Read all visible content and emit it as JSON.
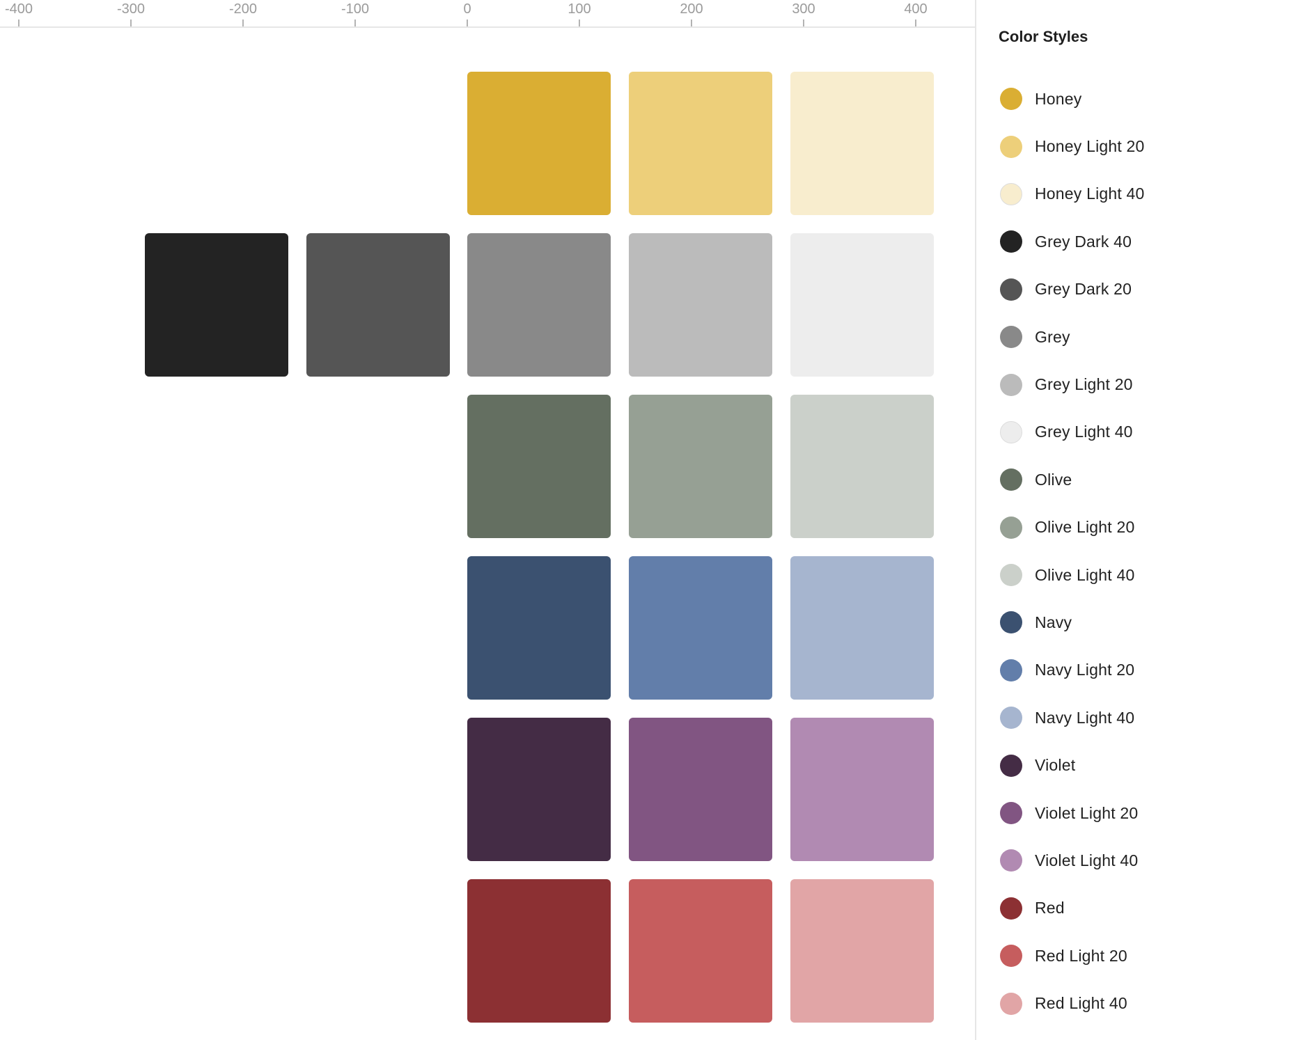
{
  "ruler": {
    "ticks": [
      "-400",
      "-300",
      "-200",
      "-100",
      "0",
      "100",
      "200",
      "300",
      "400"
    ]
  },
  "canvas": {
    "rows": [
      {
        "name": "honey",
        "swatches": [
          "",
          "",
          "#DAAE33",
          "#EDCF7A",
          "#F8EDCE"
        ]
      },
      {
        "name": "grey",
        "swatches": [
          "#232323",
          "#555555",
          "#898989",
          "#BBBBBB",
          "#EDEDED"
        ]
      },
      {
        "name": "olive",
        "swatches": [
          "",
          "",
          "#646F61",
          "#96A094",
          "#CBD0CA"
        ]
      },
      {
        "name": "navy",
        "swatches": [
          "",
          "",
          "#3B5170",
          "#627EAA",
          "#A6B5CF"
        ]
      },
      {
        "name": "violet",
        "swatches": [
          "",
          "",
          "#442C45",
          "#815582",
          "#B18AB2"
        ]
      },
      {
        "name": "red",
        "swatches": [
          "",
          "",
          "#8C3033",
          "#C65D5E",
          "#E1A5A6"
        ]
      }
    ]
  },
  "panel": {
    "title": "Color Styles",
    "styles": [
      {
        "label": "Honey",
        "color": "#DAAE33"
      },
      {
        "label": "Honey Light 20",
        "color": "#EDCF7A"
      },
      {
        "label": "Honey Light 40",
        "color": "#F8EDCE"
      },
      {
        "label": "Grey Dark 40",
        "color": "#232323"
      },
      {
        "label": "Grey Dark 20",
        "color": "#555555"
      },
      {
        "label": "Grey",
        "color": "#898989"
      },
      {
        "label": "Grey Light 20",
        "color": "#BBBBBB"
      },
      {
        "label": "Grey Light 40",
        "color": "#EDEDED"
      },
      {
        "label": "Olive",
        "color": "#646F61"
      },
      {
        "label": "Olive Light 20",
        "color": "#96A094"
      },
      {
        "label": "Olive Light 40",
        "color": "#CBD0CA"
      },
      {
        "label": "Navy",
        "color": "#3B5170"
      },
      {
        "label": "Navy Light 20",
        "color": "#627EAA"
      },
      {
        "label": "Navy Light 40",
        "color": "#A6B5CF"
      },
      {
        "label": "Violet",
        "color": "#442C45"
      },
      {
        "label": "Violet Light 20",
        "color": "#815582"
      },
      {
        "label": "Violet Light 40",
        "color": "#B18AB2"
      },
      {
        "label": "Red",
        "color": "#8C3033"
      },
      {
        "label": "Red Light 20",
        "color": "#C65D5E"
      },
      {
        "label": "Red Light 40",
        "color": "#E1A5A6"
      }
    ]
  }
}
